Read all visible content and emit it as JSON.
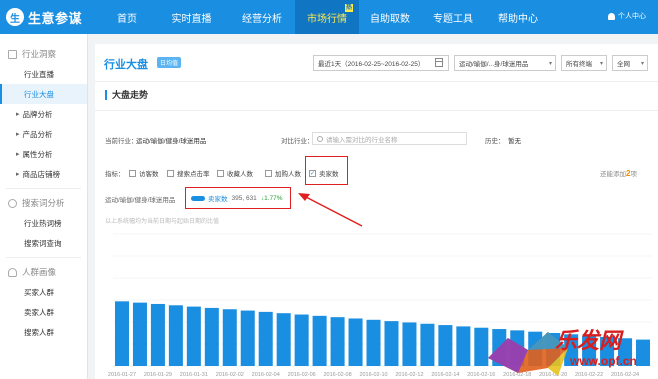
{
  "app": {
    "logo_char": "生",
    "name": "生意参谋"
  },
  "nav": [
    {
      "label": "首页",
      "active": false
    },
    {
      "label": "实时直播",
      "active": false
    },
    {
      "label": "经营分析",
      "active": false
    },
    {
      "label": "市场行情",
      "active": true,
      "badge": "热"
    },
    {
      "label": "自助取数",
      "active": false
    },
    {
      "label": "专题工具",
      "active": false
    },
    {
      "label": "帮助中心",
      "active": false
    }
  ],
  "user": {
    "label": "个人中心"
  },
  "sidebar": {
    "group1": "行业洞察",
    "items1": [
      "行业直播",
      "行业大盘",
      "品牌分析",
      "产品分析",
      "属性分析",
      "商品店铺榜"
    ],
    "group2": "搜索词分析",
    "items2": [
      "行业热词榜",
      "搜索词查询"
    ],
    "group3": "人群画像",
    "items3": [
      "买家人群",
      "卖家人群",
      "搜索人群"
    ]
  },
  "main": {
    "title": "行业大盘",
    "badge": "日均值",
    "date_range": "最近1天（2016-02-25~2016-02-25）",
    "category_select": "运动/瑜伽/...身/球迷用品",
    "terminal_select": "所有终端",
    "region_select": "全网",
    "section_title": "大盘走势",
    "current_industry_label": "当前行业：",
    "current_industry": "运动/瑜伽/健身/球迷用品",
    "compare_label": "对比行业：",
    "compare_placeholder": "请输入需对比的行业名称",
    "history_label": "历史：",
    "history_value": "暂无",
    "metrics_label": "指标：",
    "metrics": [
      {
        "label": "访客数",
        "checked": false
      },
      {
        "label": "搜索点击率",
        "checked": false
      },
      {
        "label": "收藏人数",
        "checked": false
      },
      {
        "label": "加购人数",
        "checked": false
      },
      {
        "label": "卖家数",
        "checked": true
      }
    ],
    "more_prefix": "还能添加",
    "more_count": "2",
    "more_suffix": "项",
    "legend_category": "运动/瑜伽/健身/球迷用品",
    "legend_series": "卖家数",
    "legend_value": "395, 631",
    "legend_change": "↓1.77%",
    "note": "以上系统幅均为当前日期与起始日期的比值"
  },
  "chart_data": {
    "type": "bar",
    "categories": [
      "2016-01-27",
      "2016-01-28",
      "2016-01-29",
      "2016-01-30",
      "2016-01-31",
      "2016-02-01",
      "2016-02-02",
      "2016-02-03",
      "2016-02-04",
      "2016-02-05",
      "2016-02-06",
      "2016-02-07",
      "2016-02-08",
      "2016-02-09",
      "2016-02-10",
      "2016-02-11",
      "2016-02-12",
      "2016-02-13",
      "2016-02-14",
      "2016-02-15",
      "2016-02-16",
      "2016-02-17",
      "2016-02-18",
      "2016-02-19",
      "2016-02-20",
      "2016-02-21",
      "2016-02-22",
      "2016-02-23",
      "2016-02-24",
      "2016-02-25"
    ],
    "values": [
      0.49,
      0.48,
      0.47,
      0.46,
      0.45,
      0.44,
      0.43,
      0.42,
      0.41,
      0.4,
      0.39,
      0.38,
      0.37,
      0.36,
      0.35,
      0.34,
      0.33,
      0.32,
      0.31,
      0.3,
      0.29,
      0.28,
      0.27,
      0.26,
      0.25,
      0.24,
      0.23,
      0.22,
      0.21,
      0.2
    ],
    "series": [
      {
        "name": "卖家数",
        "color": "#1a8ee0"
      }
    ],
    "ylim": [
      0,
      1
    ],
    "grid": true
  },
  "watermark": {
    "text": "乐发网",
    "url": "www.opf.cn"
  }
}
